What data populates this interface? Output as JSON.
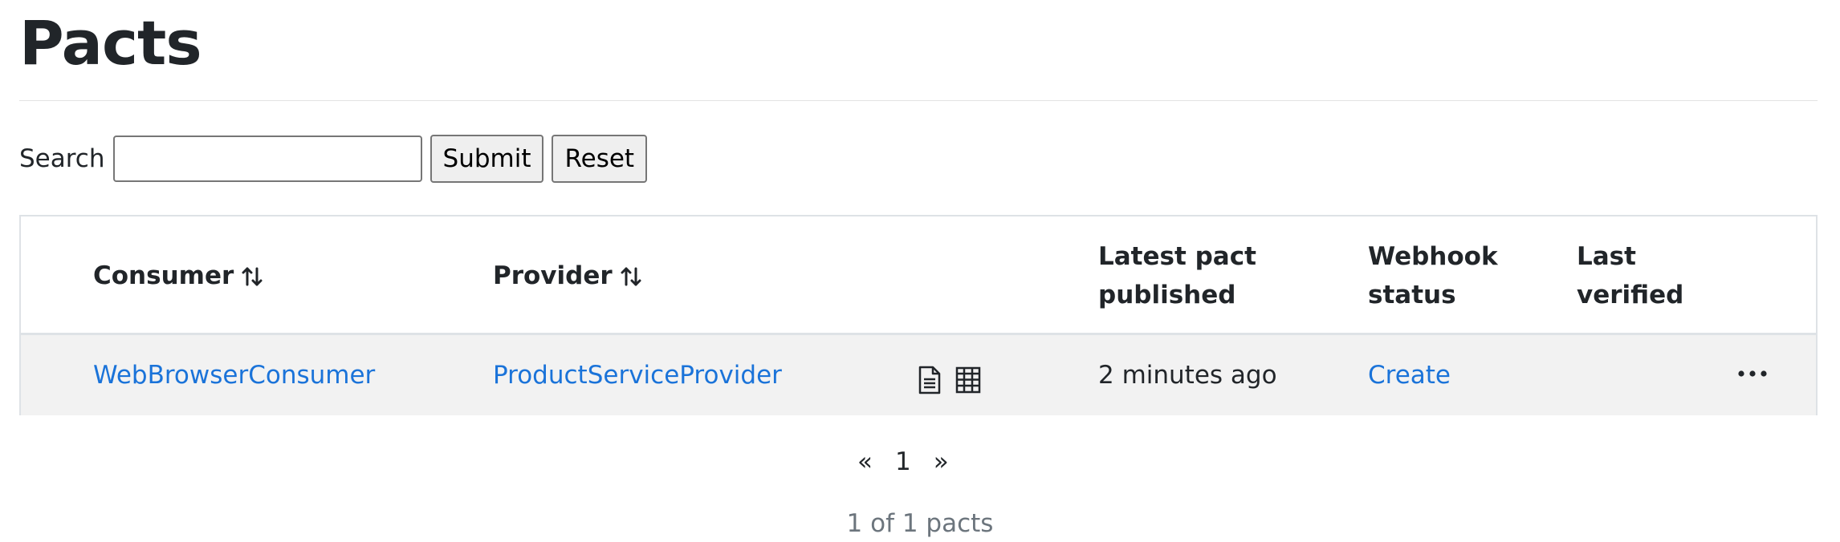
{
  "page": {
    "title": "Pacts"
  },
  "search": {
    "label": "Search",
    "value": "",
    "placeholder": "",
    "submit_label": "Submit",
    "reset_label": "Reset"
  },
  "table": {
    "headers": {
      "consumer": "Consumer",
      "provider": "Provider",
      "latest_pact_published_line1": "Latest pact",
      "latest_pact_published_line2": "published",
      "webhook_status_line1": "Webhook",
      "webhook_status_line2": "status",
      "last_verified_line1": "Last",
      "last_verified_line2": "verified"
    },
    "icons": {
      "sort": "sort-arrows-icon",
      "document": "document-icon",
      "matrix": "grid-matrix-icon",
      "menu": "ellipsis-icon"
    },
    "rows": [
      {
        "consumer": "WebBrowserConsumer",
        "provider": "ProductServiceProvider",
        "latest_pact_published": "2 minutes ago",
        "webhook_status": "Create",
        "last_verified": "",
        "menu_label": "···"
      }
    ]
  },
  "pagination": {
    "prev": "«",
    "current": "1",
    "next": "»",
    "summary": "1 of 1 pacts"
  },
  "colors": {
    "link": "#1a73d9",
    "row_background": "#f2f2f2",
    "border": "#dee2e6",
    "muted_text": "#6c757d"
  }
}
